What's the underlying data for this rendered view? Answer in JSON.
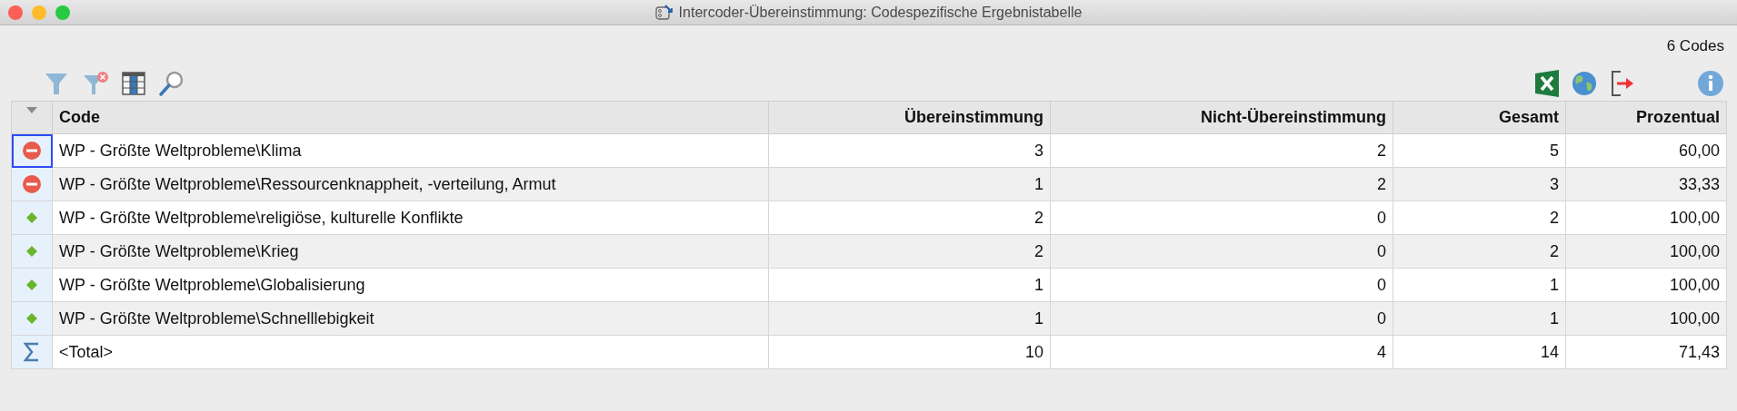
{
  "window": {
    "title": "Intercoder-Übereinstimmung: Codespezifische Ergebnistabelle"
  },
  "code_count": "6 Codes",
  "table": {
    "columns": [
      "Code",
      "Übereinstimmung",
      "Nicht-Übereinstimmung",
      "Gesamt",
      "Prozentual"
    ],
    "rows": [
      {
        "kind": "disagree",
        "selected": true,
        "cells": [
          "WP - Größte Weltprobleme\\Klima",
          "3",
          "2",
          "5",
          "60,00"
        ]
      },
      {
        "kind": "disagree",
        "selected": false,
        "cells": [
          "WP - Größte Weltprobleme\\Ressourcenknappheit, -verteilung, Armut",
          "1",
          "2",
          "3",
          "33,33"
        ]
      },
      {
        "kind": "agree",
        "selected": false,
        "cells": [
          "WP - Größte Weltprobleme\\religiöse, kulturelle Konflikte",
          "2",
          "0",
          "2",
          "100,00"
        ]
      },
      {
        "kind": "agree",
        "selected": false,
        "cells": [
          "WP - Größte Weltprobleme\\Krieg",
          "2",
          "0",
          "2",
          "100,00"
        ]
      },
      {
        "kind": "agree",
        "selected": false,
        "cells": [
          "WP - Größte Weltprobleme\\Globalisierung",
          "1",
          "0",
          "1",
          "100,00"
        ]
      },
      {
        "kind": "agree",
        "selected": false,
        "cells": [
          "WP - Größte Weltprobleme\\Schnelllebigkeit",
          "1",
          "0",
          "1",
          "100,00"
        ]
      },
      {
        "kind": "total",
        "selected": false,
        "cells": [
          "<Total>",
          "10",
          "4",
          "14",
          "71,43"
        ]
      }
    ]
  }
}
